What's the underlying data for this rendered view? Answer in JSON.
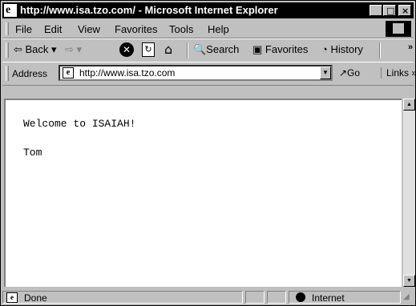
{
  "window": {
    "title": "http://www.isa.tzo.com/ - Microsoft Internet Explorer"
  },
  "menu": {
    "file": "File",
    "edit": "Edit",
    "view": "View",
    "favorites": "Favorites",
    "tools": "Tools",
    "help": "Help"
  },
  "toolbar": {
    "back": "⇦ Back ▾",
    "forward": "⇨ ▾",
    "stop": "✕",
    "refresh": "↻",
    "home": "⌂",
    "search": "🔍Search",
    "favorites": "Favorites",
    "history": "History",
    "more": "»"
  },
  "address": {
    "label": "Address",
    "url": "http://www.isa.tzo.com",
    "go": "↗Go",
    "links": "Links »"
  },
  "content": {
    "line1": "Welcome to ISAIAH!",
    "line2": "Tom"
  },
  "status": {
    "text": "Done",
    "zone": "Internet"
  },
  "icons": {
    "page_icon": "e"
  }
}
